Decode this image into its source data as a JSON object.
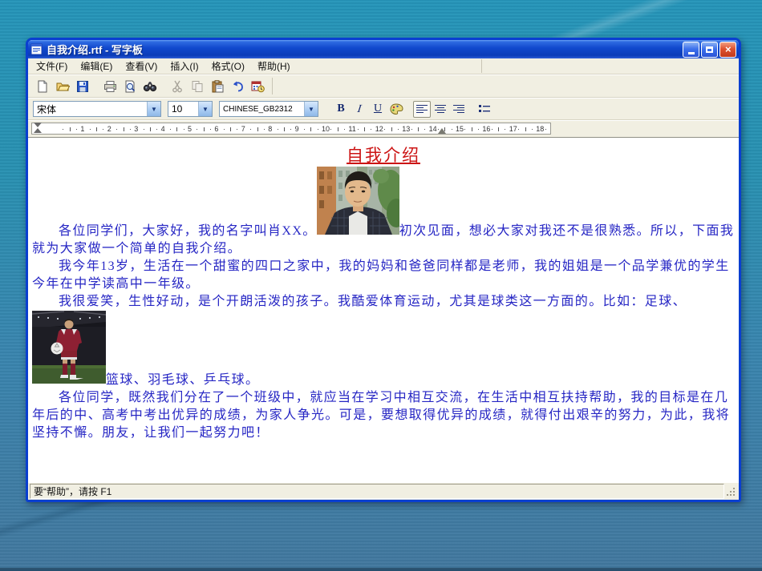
{
  "window": {
    "title": "自我介绍.rtf - 写字板"
  },
  "menu": {
    "items": [
      "文件(F)",
      "编辑(E)",
      "查看(V)",
      "插入(I)",
      "格式(O)",
      "帮助(H)"
    ]
  },
  "toolbar": {
    "icons": [
      "new-document-icon",
      "open-icon",
      "save-icon",
      "print-icon",
      "print-preview-icon",
      "find-icon",
      "cut-icon",
      "copy-icon",
      "paste-icon",
      "undo-icon",
      "date-time-icon"
    ]
  },
  "formatbar": {
    "font_value": "宋体",
    "size_value": "10",
    "charset_value": "CHINESE_GB2312",
    "bold_label": "B",
    "italic_label": "I",
    "underline_label": "U",
    "icons": [
      "font-color-icon",
      "align-left-icon",
      "align-center-icon",
      "align-right-icon",
      "bullets-icon"
    ]
  },
  "ruler": {
    "numbers": [
      1,
      2,
      3,
      4,
      5,
      6,
      7,
      8,
      9,
      10,
      11,
      12,
      13,
      14,
      15,
      16,
      17,
      18
    ]
  },
  "document": {
    "title": "自我介绍",
    "para1_part1": "各位同学们，大家好，我的名字叫肖XX。",
    "para1_part2": "初次见面，想必大家对我还不是很熟悉。所以，下面我就为大家做一个简单的自我介绍。",
    "para2": "我今年13岁，生活在一个甜蜜的四口之家中，我的妈妈和爸爸同样都是老师，我的姐姐是一个品学兼优的学生今年在中学读高中一年级。",
    "para3_part1": "我很爱笑，生性好动，是个开朗活泼的孩子。我酷爱体育运动，尤其是球类这一方面的。比如：足球、",
    "para3_part2": "篮球、羽毛球、乒乓球。",
    "para4": "各位同学，既然我们分在了一个班级中，就应当在学习中相互交流，在生活中相互扶持帮助，我的目标是在几年后的中、高考中考出优异的成绩，为家人争光。可是，要想取得优异的成绩，就得付出艰辛的努力，为此，我将坚持不懈。朋友，让我们一起努力吧！",
    "photos": [
      "boy-portrait-photo",
      "soccer-player-photo"
    ]
  },
  "statusbar": {
    "text": "要“帮助”，请按 F1"
  },
  "colors": {
    "titlebar_blue": "#1149ce",
    "window_border_blue": "#0a3fd0",
    "doc_title_red": "#cc1414",
    "body_text_blue": "#2626c4",
    "background_teal": "#2a92b2"
  }
}
